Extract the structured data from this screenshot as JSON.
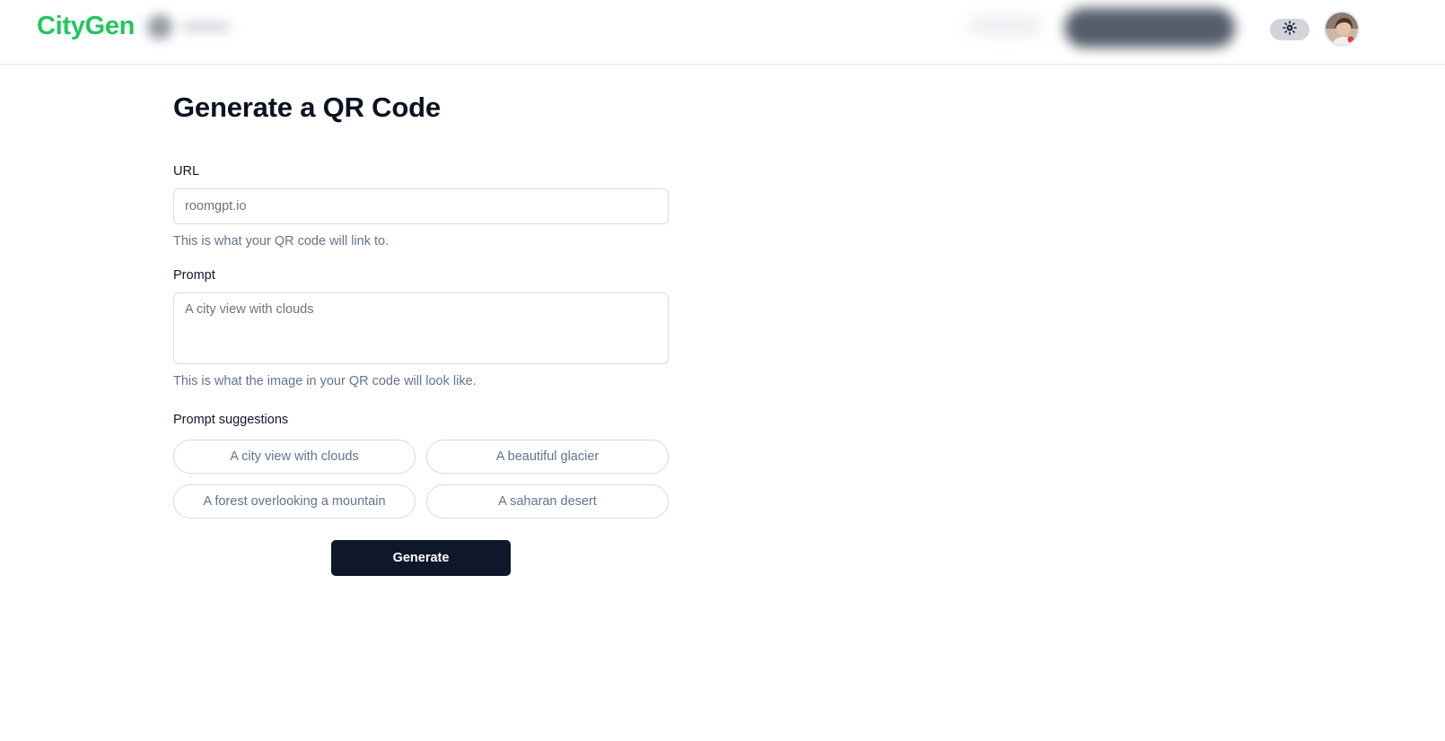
{
  "header": {
    "brand": "CityGen",
    "theme_toggle_icon": "sun-icon",
    "avatar_icon": "user-avatar"
  },
  "form": {
    "title": "Generate a QR Code",
    "url": {
      "label": "URL",
      "placeholder": "roomgpt.io",
      "value": "",
      "helper": "This is what your QR code will link to."
    },
    "prompt": {
      "label": "Prompt",
      "placeholder": "A city view with clouds",
      "value": "",
      "helper": "This is what the image in your QR code will look like."
    },
    "suggestions": {
      "label": "Prompt suggestions",
      "items": [
        "A city view with clouds",
        "A beautiful glacier",
        "A forest overlooking a mountain",
        "A saharan desert"
      ]
    },
    "generate_label": "Generate"
  },
  "colors": {
    "brand": "#22c55e",
    "primary_button": "#0f172a",
    "muted_text": "#64748b",
    "border": "#d7dbe0"
  }
}
